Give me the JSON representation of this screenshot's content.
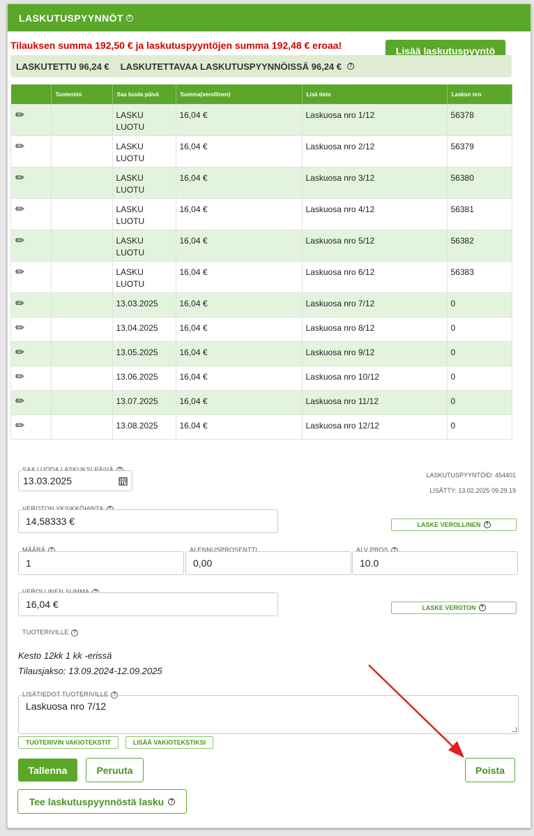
{
  "header": {
    "title": "LASKUTUSPYYNNÖT"
  },
  "warning": "Tilauksen summa 192,50 € ja laskutuspyyntöjen summa 192,48 € eroaa!",
  "add_button": "Lisää laskutuspyyntö",
  "summary": {
    "invoiced": "LASKUTETTU 96,24 €",
    "to_invoice": "LASKUTETTAVAA LASKUTUSPYYNNÖISSÄ 96,24 €"
  },
  "table": {
    "columns": [
      "",
      "Tuotenimi",
      "Saa luoda päivä",
      "Summa(verollinen)",
      "Lisä tieto",
      "Laskun nro"
    ],
    "rows": [
      {
        "name": "",
        "date": "LASKU LUOTU",
        "sum": "16,04 €",
        "info": "Laskuosa nro 1/12",
        "nro": "56378"
      },
      {
        "name": "",
        "date": "LASKU LUOTU",
        "sum": "16,04 €",
        "info": "Laskuosa nro 2/12",
        "nro": "56379"
      },
      {
        "name": "",
        "date": "LASKU LUOTU",
        "sum": "16,04 €",
        "info": "Laskuosa nro 3/12",
        "nro": "56380"
      },
      {
        "name": "",
        "date": "LASKU LUOTU",
        "sum": "16,04 €",
        "info": "Laskuosa nro 4/12",
        "nro": "56381"
      },
      {
        "name": "",
        "date": "LASKU LUOTU",
        "sum": "16,04 €",
        "info": "Laskuosa nro 5/12",
        "nro": "56382"
      },
      {
        "name": "",
        "date": "LASKU LUOTU",
        "sum": "16,04 €",
        "info": "Laskuosa nro 6/12",
        "nro": "56383"
      },
      {
        "name": "",
        "date": "13.03.2025",
        "sum": "16,04 €",
        "info": "Laskuosa nro 7/12",
        "nro": "0"
      },
      {
        "name": "",
        "date": "13.04.2025",
        "sum": "16,04 €",
        "info": "Laskuosa nro 8/12",
        "nro": "0"
      },
      {
        "name": "",
        "date": "13.05.2025",
        "sum": "16,04 €",
        "info": "Laskuosa nro 9/12",
        "nro": "0"
      },
      {
        "name": "",
        "date": "13.06.2025",
        "sum": "16,04 €",
        "info": "Laskuosa nro 10/12",
        "nro": "0"
      },
      {
        "name": "",
        "date": "13.07.2025",
        "sum": "16,04 €",
        "info": "Laskuosa nro 11/12",
        "nro": "0"
      },
      {
        "name": "",
        "date": "13.08.2025",
        "sum": "16,04 €",
        "info": "Laskuosa nro 12/12",
        "nro": "0"
      }
    ]
  },
  "form": {
    "date_label": "SAA LUODA LASKUKSI PÄIVÄ",
    "date_value": "13.03.2025",
    "request_id": "LASKUTUSPYYNTÖID: 454401",
    "added": "LISÄTTY: 13.02.2025 09.29.19",
    "unit_price_label": "VEROTON YKSIKKÖHINTA",
    "unit_price_value": "14,58333 €",
    "calc_gross": "LASKE VEROLLINEN",
    "qty_label": "MÄÄRÄ",
    "qty_value": "1",
    "discount_label": "ALENNUSPROSENTTI",
    "discount_value": "0,00",
    "vat_label": "ALV PROS",
    "vat_value": "10.0",
    "gross_label": "VEROLLINEN SUMMA",
    "gross_value": "16,04 €",
    "calc_net": "LASKE VEROTON",
    "product_row_label": "TUOTERIVILLE",
    "duration": "Kesto 12kk 1 kk -erissä",
    "period": "Tilausjakso: 13.09.2024-12.09.2025",
    "extra_label": "LISÄTIEDOT TUOTERIVILLE",
    "extra_value": "Laskuosa nro 7/12",
    "std_texts": "TUOTERIVIN VAKIOTEKSTIT",
    "add_std_text": "LISÄÄ VAKIOTEKSTIKSI"
  },
  "buttons": {
    "save": "Tallenna",
    "cancel": "Peruuta",
    "delete": "Poista",
    "make_invoice": "Tee laskutuspyynnöstä lasku"
  },
  "colors": {
    "brand": "#5aa72a",
    "warning": "#d60000",
    "row_alt": "#e2f4dd",
    "arrow": "#e02020"
  }
}
